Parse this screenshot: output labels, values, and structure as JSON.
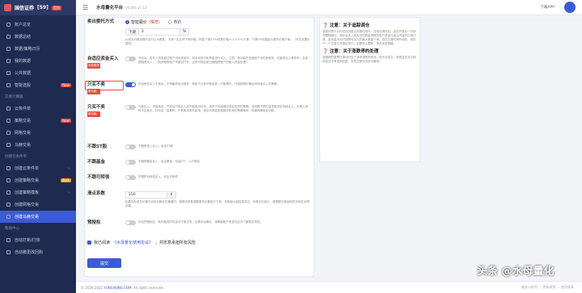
{
  "app": {
    "logo_text": "国信证券",
    "logo_badge": "[59]",
    "logo_tag": "官网"
  },
  "sidebar": {
    "items": [
      {
        "label": "账户总览"
      },
      {
        "label": "数据总结"
      },
      {
        "label": "数据/策略日历"
      },
      {
        "label": "我的数据"
      },
      {
        "label": "公共数据"
      },
      {
        "label": "智能选股",
        "tag": "New"
      }
    ],
    "group1": "交易计算器",
    "items2": [
      {
        "label": "云条件单"
      },
      {
        "label": "策略交易",
        "tag": "New"
      },
      {
        "label": "网格交易"
      },
      {
        "label": "马赫交易"
      }
    ],
    "group2": "创建云条件单",
    "items3": [
      {
        "label": "创建云条件单"
      },
      {
        "label": "创建策略交易",
        "tag": "Beta"
      },
      {
        "label": "创建策略模板"
      },
      {
        "label": "创建网格交易"
      },
      {
        "label": "创建马赫交易",
        "active": true
      }
    ],
    "group3": "帮助中心",
    "items4": [
      {
        "label": "自动打新/打债"
      },
      {
        "label": "自动撤更改回购"
      }
    ]
  },
  "topbar": {
    "title": "水母量化平台",
    "version": "v4.0/ts v1.12",
    "download": "下载APP"
  },
  "form": {
    "rows": [
      {
        "label": "卖出委托方式",
        "radio1": "智能跟价",
        "radio1_hl": "(推荐)",
        "radio2": "市价"
      },
      {
        "prefix": "下调",
        "value": "2",
        "suffix": "%",
        "desc": "以成本价格涨跌的百分比为基准，下调一定比例下单价格。例如下调0.5%则按价格×(1-0.5%)下单；下调0%则直接以委托价格下单，（可在设置中更改）"
      },
      {
        "label": "自适应资金买入",
        "tag": "系统推荐",
        "desc": "开启后，若买入资金超过账户可用资金时，将自动按可用资金进行买入。注意：该功能在信用账户中仍然有效，在触发买入条件时，会按照融资买入，（融资融券账户不建议打开，否则可能会被当做融资账户的借入资金处理）"
      },
      {
        "label": "只买不卖",
        "tag": "新功能",
        "desc": "开启即仅买入不卖出，不再触发卖出操作。常用于分批不断选择一只股票时，只能按照价格区间持续买入的策略。"
      },
      {
        "label": "只买不卖",
        "tag": "新功能",
        "desc": "只能买入，不能卖出。开启后只能买入而不能卖出持仓，适用于持续建仓或定投型的策略。当网格下跌时会按照设定持续买入，价格上涨时不会卖出，持仓会一直累积，不受卖出条件影响，适合长期定投或建仓阶段的策略使用，请谨慎使用此功能。"
      },
      {
        "label": "不跟ST股",
        "desc": "不跟踪进入买入，卖出ST股"
      },
      {
        "label": "不跟基金",
        "desc": "不跟踪基金买入，卖出基金，包括ETF、LOF基金"
      },
      {
        "label": "不跟可转债",
        "desc": "不跟踪可转债买入，卖出可转债"
      },
      {
        "label": "滑点系数",
        "value": "150",
        "desc": "如果实际成交价格与目标价格存在偏差时，按照该系数调整委托价格进行下单；系数越大越容易成交，但滑点也越大，请根据交易品种的流动性合理设置。"
      },
      {
        "label": "预授权",
        "desc": "开启预授权后，条件触发时将自动下单交易，无需手动确认，请确保账户资金充足并了解相关风险。"
      }
    ],
    "agree_prefix": "我已阅读",
    "agree_link": "《水母量化使用协议》",
    "agree_suffix": "，并愿意承担所有风险",
    "submit": "提交"
  },
  "notes": {
    "h1": "注意：关于追踪调仓",
    "p1": "追踪的是平台内设定的组合的调仓指令，当组合调仓后，会在开盘后一分钟内跟随调仓。调仓后买入或卖出的数量按照您账户资金与组合资金的比例计算，若资金不足时按照可买入的最大数量下单。若在交易时间外调仓，将在下一个交易日开盘后执行。如需停止跟踪，请关闭本策略。",
    "h2": "注意：关于涨跌停的处理",
    "p2": "若跟踪的股票在调仓时处于涨停或跌停状态，将无法成交，系统会在当日持续尝试下单直到收盘，未成交部分将自动撤单。"
  },
  "footer": {
    "copyright": "© 2020-2022",
    "site": "YUNCAIJING.COM",
    "rights": ". All rights reserved.",
    "right": "服务与权利 ｜ 隐私政策 ｜ 使用条款"
  },
  "watermark": "头条 @水母量化"
}
